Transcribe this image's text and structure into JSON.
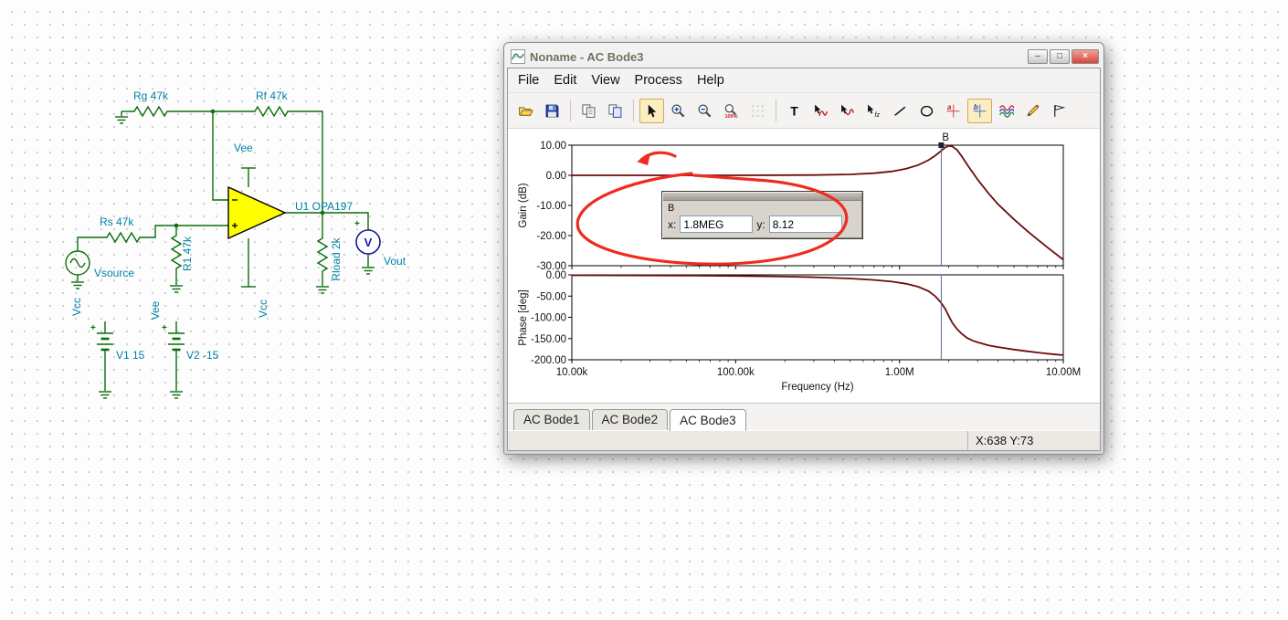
{
  "schematic": {
    "labels": {
      "rg": "Rg 47k",
      "rf": "Rf 47k",
      "vee_top": "Vee",
      "rs": "Rs 47k",
      "u1": "U1 OPA197",
      "vsource": "Vsource",
      "r1": "R1 47k",
      "rload": "Rload 2k",
      "vout": "Vout",
      "vcc_bottom": "Vcc",
      "vcc_left": "Vcc",
      "vee_mid": "Vee",
      "v1": "V1 15",
      "v2": "V2 -15",
      "meter": "V",
      "plus": "+"
    },
    "wire_color": "#0b6d0b",
    "label_color": "#0081a7",
    "opamp_fill": "#ffff00",
    "vout_color": "#b000b0",
    "meter_color": "#1515cc"
  },
  "window": {
    "title": "Noname - AC Bode3",
    "menu": [
      "File",
      "Edit",
      "View",
      "Process",
      "Help"
    ],
    "window_buttons": [
      {
        "name": "minimize-button",
        "glyph": "–"
      },
      {
        "name": "maximize-button",
        "glyph": "□"
      },
      {
        "name": "close-button",
        "glyph": "×"
      }
    ],
    "toolbar": [
      {
        "name": "open-button",
        "icon": "folder-open-icon"
      },
      {
        "name": "save-button",
        "icon": "floppy-icon"
      },
      {
        "sep": true
      },
      {
        "name": "copy-button",
        "icon": "copy-icon"
      },
      {
        "name": "copy-special-button",
        "icon": "paste-icon"
      },
      {
        "sep": true
      },
      {
        "name": "pointer-tool-button",
        "icon": "arrow-cursor-icon",
        "pressed": true
      },
      {
        "name": "zoom-in-button",
        "icon": "zoom-in-icon"
      },
      {
        "name": "zoom-out-button",
        "icon": "zoom-out-icon"
      },
      {
        "name": "zoom-100-button",
        "icon": "zoom-100-icon"
      },
      {
        "name": "grid-toggle-button",
        "icon": "grid-icon",
        "disabled": true
      },
      {
        "sep": true
      },
      {
        "name": "text-tool-button",
        "icon": "text-icon"
      },
      {
        "name": "cursor-a-tool-button",
        "icon": "cursor-curve-icon"
      },
      {
        "name": "cursor-b-tool-button",
        "icon": "cursor-curve-alt-icon"
      },
      {
        "name": "autoscale-tool-button",
        "icon": "cursor-axis-icon"
      },
      {
        "name": "line-tool-button",
        "icon": "line-icon"
      },
      {
        "name": "ellipse-tool-button",
        "icon": "ellipse-icon"
      },
      {
        "name": "marker-a-button",
        "icon": "crosshair-a-icon"
      },
      {
        "name": "marker-b-button",
        "icon": "crosshair-b-icon",
        "pressed": true
      },
      {
        "name": "curves-dialog-button",
        "icon": "waves-icon"
      },
      {
        "name": "annotation-pen-button",
        "icon": "pen-icon"
      },
      {
        "name": "legend-flag-button",
        "icon": "flag-icon"
      }
    ],
    "tabs": [
      {
        "label": "AC Bode1",
        "active": false
      },
      {
        "label": "AC Bode2",
        "active": false
      },
      {
        "label": "AC Bode3",
        "active": true
      }
    ],
    "status_right": "X:638  Y:73"
  },
  "cursor_panel": {
    "title": "B",
    "x_label": "x:",
    "x_value": "1.8MEG",
    "y_label": "y:",
    "y_value": "8.12"
  },
  "colors": {
    "annotation": "#ef2b1e",
    "curve": "#6e0b0b",
    "cursor_line": "#5a6aa0"
  },
  "chart_data": [
    {
      "type": "line",
      "ylabel": "Gain (dB)",
      "xlabel": "Frequency (Hz)",
      "x_scale": "log",
      "xlim": [
        10000,
        10000000
      ],
      "ylim": [
        -30,
        10
      ],
      "yticks": [
        10,
        0,
        -10,
        -20,
        -30
      ],
      "ytick_labels": [
        "10.00",
        "0.00",
        "-10.00",
        "-20.00",
        "-30.00"
      ],
      "xticks": [
        10000,
        100000,
        1000000,
        10000000
      ],
      "xtick_labels": [
        "10.00k",
        "100.00k",
        "1.00M",
        "10.00M"
      ],
      "grid": false,
      "series": [
        {
          "name": "Gain",
          "color": "#6e0b0b",
          "x": [
            10000,
            20000,
            50000,
            100000,
            200000,
            300000,
            500000,
            700000,
            900000,
            1100000,
            1300000,
            1500000,
            1650000,
            1800000,
            1900000,
            2000000,
            2100000,
            2250000,
            2400000,
            2600000,
            2800000,
            3000000,
            3500000,
            4000000,
            5000000,
            6000000,
            7000000,
            8000000,
            9000000,
            10000000
          ],
          "y": [
            0,
            0,
            0,
            0,
            0.05,
            0.1,
            0.3,
            0.7,
            1.3,
            2.2,
            3.4,
            5.0,
            6.5,
            8.12,
            9.2,
            9.8,
            9.6,
            8.4,
            6.3,
            3.4,
            0.9,
            -1.4,
            -6.0,
            -9.6,
            -14.6,
            -18.4,
            -21.4,
            -23.9,
            -26.1,
            -28.0
          ]
        }
      ],
      "cursor": {
        "label": "B",
        "x": 1800000,
        "y": 8.12
      }
    },
    {
      "type": "line",
      "ylabel": "Phase [deg]",
      "xlabel": "Frequency (Hz)",
      "x_scale": "log",
      "xlim": [
        10000,
        10000000
      ],
      "ylim": [
        -200,
        0
      ],
      "yticks": [
        0,
        -50,
        -100,
        -150,
        -200
      ],
      "ytick_labels": [
        "0.00",
        "-50.00",
        "-100.00",
        "-150.00",
        "-200.00"
      ],
      "xticks": [
        10000,
        100000,
        1000000,
        10000000
      ],
      "xtick_labels": [
        "10.00k",
        "100.00k",
        "1.00M",
        "10.00M"
      ],
      "grid": false,
      "series": [
        {
          "name": "Phase",
          "color": "#6e0b0b",
          "x": [
            10000,
            20000,
            50000,
            100000,
            200000,
            300000,
            500000,
            700000,
            900000,
            1100000,
            1300000,
            1500000,
            1650000,
            1800000,
            1900000,
            2000000,
            2100000,
            2250000,
            2400000,
            2600000,
            2800000,
            3000000,
            3500000,
            4000000,
            5000000,
            6000000,
            7000000,
            8000000,
            9000000,
            10000000
          ],
          "y": [
            -1,
            -1.2,
            -1.8,
            -2.5,
            -4,
            -5.5,
            -8.5,
            -12,
            -16,
            -21,
            -28,
            -38,
            -50,
            -66,
            -80,
            -97,
            -113,
            -128,
            -139,
            -149,
            -155,
            -159,
            -166,
            -170,
            -176,
            -180,
            -183,
            -185.5,
            -187.5,
            -189
          ]
        }
      ],
      "cursor": {
        "x": 1800000
      }
    }
  ]
}
